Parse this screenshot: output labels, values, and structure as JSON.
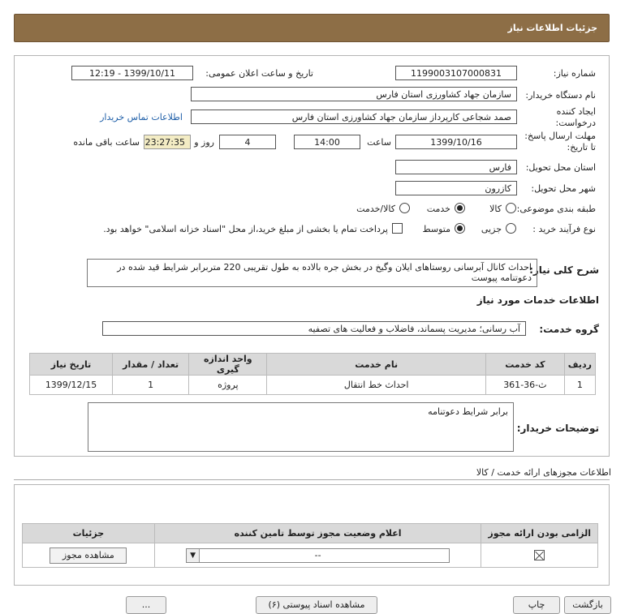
{
  "header": {
    "title": "جزئیات اطلاعات نیاز"
  },
  "form": {
    "need_number_label": "شماره نیاز:",
    "need_number": "1199003107000831",
    "announce_label": "تاریخ و ساعت اعلان عمومی:",
    "announce_value": "1399/10/11 - 12:19",
    "buyer_org_label": "نام دستگاه خریدار:",
    "buyer_org": "سازمان جهاد کشاورزی استان فارس",
    "creator_label": "ایجاد کننده درخواست:",
    "creator": "صمد شجاعی کارپرداز سازمان جهاد کشاورزی استان فارس",
    "contact_link": "اطلاعات تماس خریدار",
    "deadline_label": "مهلت ارسال پاسخ: تا تاریخ:",
    "deadline_date": "1399/10/16",
    "time_label": "ساعت",
    "deadline_time": "14:00",
    "days_value": "4",
    "days_label": "روز و",
    "remaining_time": "23:27:35",
    "remaining_label": "ساعت باقی مانده",
    "province_label": "استان محل تحویل:",
    "province": "فارس",
    "city_label": "شهر محل تحویل:",
    "city": "کازرون",
    "category_label": "طبقه بندی موضوعی:",
    "category_options": [
      "کالا",
      "خدمت",
      "کالا/خدمت"
    ],
    "category_selected": "خدمت",
    "process_label": "نوع فرآیند خرید :",
    "process_options": [
      "جزیی",
      "متوسط"
    ],
    "process_selected": "متوسط",
    "payment_text": "پرداخت تمام یا بخشی از مبلغ خرید،از محل \"اسناد خزانه اسلامی\" خواهد بود."
  },
  "summary": {
    "label": "شرح کلی نیاز:",
    "text": "احداث کانال آبرسانی روستاهای   ایلان وگیخ     در بخش جره بالاده  به طول تقریبی 220 متربرابر شرایط قید شده در دعوتنامه پیوست"
  },
  "services": {
    "heading": "اطلاعات خدمات مورد نیاز",
    "group_label": "گروه خدمت:",
    "group_value": "آب رسانی؛ مدیریت پسماند، فاضلاب و فعالیت های تصفیه",
    "columns": [
      "ردیف",
      "کد خدمت",
      "نام خدمت",
      "واحد اندازه گیری",
      "تعداد / مقدار",
      "تاریخ نیاز"
    ],
    "rows": [
      {
        "index": "1",
        "code": "ث-36-361",
        "name": "احداث خط انتقال",
        "unit": "پروژه",
        "qty": "1",
        "date": "1399/12/15"
      }
    ]
  },
  "buyer_notes": {
    "label": "توضیحات خریدار:",
    "text": "برابر شرایط دعوتنامه"
  },
  "licenses": {
    "title": "اطلاعات مجوزهای ارائه خدمت / کالا",
    "columns": [
      "الزامی بودن ارائه مجوز",
      "اعلام وضعیت مجوز توسط تامین کننده",
      "جزئیات"
    ],
    "select_value": "--",
    "view_button": "مشاهده مجوز"
  },
  "footer": {
    "buttons": [
      "بازگشت",
      "چاپ",
      "مشاهده اسناد پیوستی (۶)",
      "..."
    ]
  }
}
